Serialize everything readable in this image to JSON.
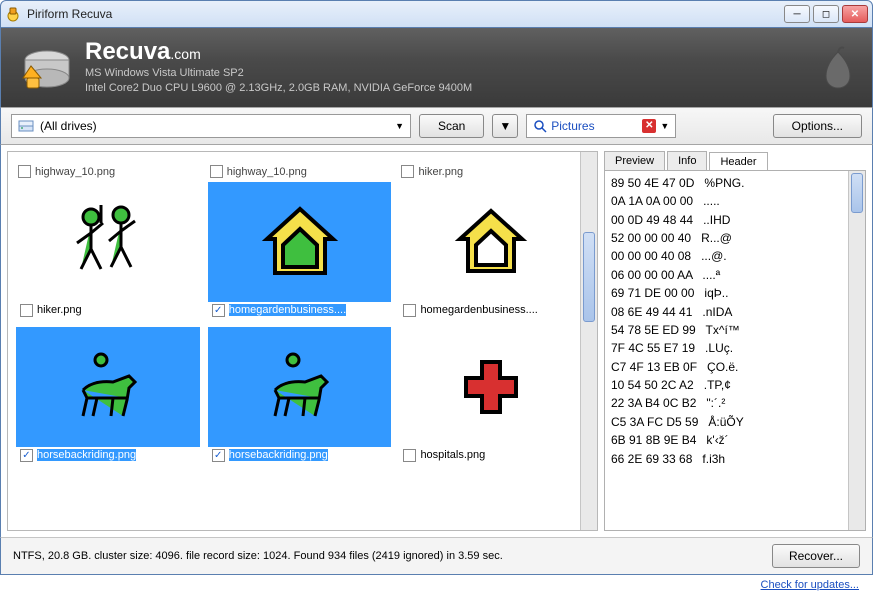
{
  "window": {
    "title": "Piriform Recuva"
  },
  "header": {
    "brand": "Recuva",
    "brand_suffix": ".com",
    "sys1": "MS Windows Vista Ultimate SP2",
    "sys2": "Intel Core2 Duo CPU L9600 @ 2.13GHz, 2.0GB RAM, NVIDIA GeForce 9400M"
  },
  "toolbar": {
    "drive_label": "(All drives)",
    "scan": "Scan",
    "filter_label": "Pictures",
    "options": "Options..."
  },
  "clipped_row": {
    "a": "highway_10.png",
    "b": "highway_10.png",
    "c": "hiker.png"
  },
  "files": [
    {
      "name": "hiker.png",
      "icon": "hikers",
      "selected": false,
      "checked": false
    },
    {
      "name": "homegardenbusiness....",
      "icon": "house-green",
      "selected": true,
      "checked": true
    },
    {
      "name": "homegardenbusiness....",
      "icon": "house-yellow",
      "selected": false,
      "checked": false
    },
    {
      "name": "horsebackriding.png",
      "icon": "horse",
      "selected": true,
      "checked": true
    },
    {
      "name": "horsebackriding.png",
      "icon": "horse",
      "selected": true,
      "checked": true
    },
    {
      "name": "hospitals.png",
      "icon": "redcross",
      "selected": false,
      "checked": false
    }
  ],
  "tabs": {
    "preview": "Preview",
    "info": "Info",
    "header": "Header",
    "active": "header"
  },
  "hex": "89 50 4E 47 0D   %PNG.\n0A 1A 0A 00 00   .....\n00 0D 49 48 44   ..IHD\n52 00 00 00 40   R...@\n00 00 00 40 08   ...@.\n06 00 00 00 AA   ....ª\n69 71 DE 00 00   iqÞ..\n08 6E 49 44 41   .nIDA\n54 78 5E ED 99   Tx^í™\n7F 4C 55 E7 19   .LUç.\nC7 4F 13 EB 0F   ÇO.ë.\n10 54 50 2C A2   .TP,¢\n22 3A B4 0C B2   \":´.²\nC5 3A FC D5 59   Å:üÕY\n6B 91 8B 9E B4   k'‹ž´\n66 2E 69 33 68   f.i3h",
  "status": "NTFS, 20.8 GB. cluster size: 4096. file record size: 1024. Found 934 files (2419 ignored) in 3.59 sec.",
  "recover": "Recover...",
  "update_link": "Check for updates..."
}
